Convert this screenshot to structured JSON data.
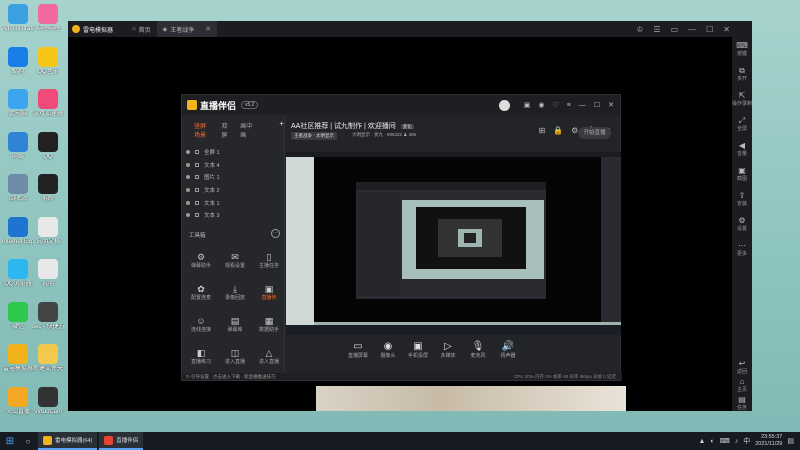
{
  "desktop": {
    "icons": [
      {
        "label": "Administrator",
        "color": "#3aa0e0"
      },
      {
        "label": "哔哩哔哩",
        "color": "#f06aa0"
      },
      {
        "label": "酷狗",
        "color": "#1a7ee8"
      },
      {
        "label": "QQ音乐",
        "color": "#f5c518"
      },
      {
        "label": "此电脑",
        "color": "#3da5f0"
      },
      {
        "label": "游戏加速器",
        "color": "#f04a7a"
      },
      {
        "label": "网络",
        "color": "#2f84d6"
      },
      {
        "label": "QQ",
        "color": "#222222"
      },
      {
        "label": "回收站",
        "color": "#6e8ca8"
      },
      {
        "label": "剪映",
        "color": "#222222"
      },
      {
        "label": "Internet Explorer",
        "color": "#1f73d1"
      },
      {
        "label": "说明文档",
        "color": "#e8e8e8"
      },
      {
        "label": "QQ浏览器",
        "color": "#2eb6f0"
      },
      {
        "label": "说明",
        "color": "#e8e8e8"
      },
      {
        "label": "微信",
        "color": "#2ec84a"
      },
      {
        "label": "sec - 快捷方式",
        "color": "#444444"
      },
      {
        "label": "雷电模拟器",
        "color": "#f2b21c"
      },
      {
        "label": "新建文件夹",
        "color": "#f2c94c"
      },
      {
        "label": "火山直播",
        "color": "#f5a623"
      },
      {
        "label": "VirtuoCam",
        "color": "#333333"
      }
    ]
  },
  "emulator": {
    "app_name": "雷电模拟器",
    "tabs": [
      {
        "label": "首页",
        "active": false
      },
      {
        "label": "王者战争",
        "active": true
      }
    ],
    "controls": [
      "♔",
      "☰",
      "▭",
      "—",
      "☐",
      "✕"
    ],
    "side_buttons": [
      {
        "glyph": "⌨",
        "label": "按键"
      },
      {
        "glyph": "⧉",
        "label": "多开"
      },
      {
        "glyph": "⇱",
        "label": "操作录制"
      },
      {
        "glyph": "⤢",
        "label": "全屏"
      },
      {
        "glyph": "◀",
        "label": "音量"
      },
      {
        "glyph": "▣",
        "label": "截图"
      },
      {
        "glyph": "⇪",
        "label": "安装"
      },
      {
        "glyph": "⚙",
        "label": "设置"
      },
      {
        "glyph": "⋯",
        "label": "更多"
      },
      {
        "glyph": "↩",
        "label": "返回"
      },
      {
        "glyph": "⌂",
        "label": "主页"
      },
      {
        "glyph": "▤",
        "label": "任务"
      }
    ]
  },
  "app": {
    "logo": "直播伴侣",
    "version": "v5.2",
    "window_controls": [
      "▣",
      "◉",
      "♡",
      "≡",
      "—",
      "☐",
      "✕"
    ],
    "scene_tabs": [
      {
        "label": "竖屏场景",
        "active": true
      },
      {
        "label": "双屏",
        "active": false
      },
      {
        "label": "画中画",
        "active": false
      }
    ],
    "scene_add": "+",
    "scenes": [
      "全屏 1",
      "文本 4",
      "图片 1",
      "文本 2",
      "文本 1",
      "文本 3"
    ],
    "tools_title": "工具箱",
    "tools_more": "···",
    "tools": [
      {
        "glyph": "⚙",
        "label": "弹幕助手"
      },
      {
        "glyph": "✉",
        "label": "观看设置"
      },
      {
        "glyph": "▯",
        "label": "主播任务"
      },
      {
        "glyph": "✿",
        "label": "配置连麦"
      },
      {
        "glyph": "⤓",
        "label": "录像回放"
      },
      {
        "glyph": "▣",
        "label": "直播伴"
      },
      {
        "glyph": "☺",
        "label": "连线连接"
      },
      {
        "glyph": "▤",
        "label": "弹幕库"
      },
      {
        "glyph": "▦",
        "label": "数据助手"
      },
      {
        "glyph": "◧",
        "label": "直播练习"
      },
      {
        "glyph": "◫",
        "label": "进入直播"
      },
      {
        "glyph": "△",
        "label": "进入直播"
      }
    ],
    "stream_title": "AA社区推荐 | 试九制作 | 欢迎播间",
    "stream_badge": "变化",
    "tag_category": "王者战争 · 太明显示",
    "tag_info": "大明显示 · 状九 · 985332",
    "view_count": "386",
    "stream_icons": [
      "⊞",
      "🔒",
      "⚙",
      "🔔",
      "↗"
    ],
    "bottom_buttons": [
      {
        "glyph": "▭",
        "label": "直播屏幕"
      },
      {
        "glyph": "◉",
        "label": "摄像头"
      },
      {
        "glyph": "▣",
        "label": "手机投屏"
      },
      {
        "glyph": "▷",
        "label": "多媒体"
      },
      {
        "glyph": "🎙",
        "label": "麦克风"
      },
      {
        "glyph": "🔊",
        "label": "扬声器"
      }
    ],
    "start_button": "开始直播",
    "status_text": "↻ 引导设置 · 点击进入下载 · 新直播推送技巧",
    "status_right": "CPU 20%  内存 0%  帧率 60  码率 0kbps  丢帧 0  延迟"
  },
  "taskbar": {
    "start_glyph": "⊞",
    "search_glyph": "○",
    "apps": [
      {
        "label": "雷电模拟器(64)",
        "color": "#f2b21c"
      },
      {
        "label": "直播伴侣",
        "color": "#e8452e"
      }
    ],
    "tray_icons": [
      "▲",
      "◐",
      "⌨",
      "♪",
      "中"
    ],
    "time": "23:55:37",
    "date": "2021/11/29"
  }
}
